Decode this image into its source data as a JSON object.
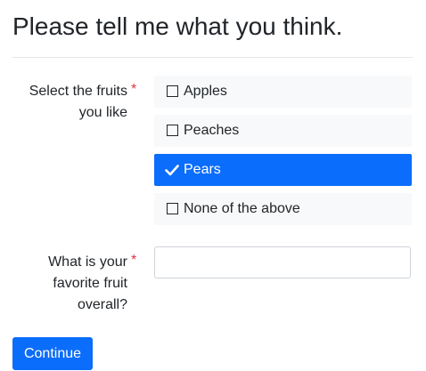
{
  "page": {
    "title": "Please tell me what you think."
  },
  "fruits_question": {
    "label_line1": "Select the fruits",
    "label_line2": "you like",
    "required_mark": "*",
    "options": [
      {
        "label": "Apples",
        "selected": false
      },
      {
        "label": "Peaches",
        "selected": false
      },
      {
        "label": "Pears",
        "selected": true
      },
      {
        "label": "None of the above",
        "selected": false
      }
    ]
  },
  "favorite_question": {
    "label_line1": "What is your",
    "label_line2": "favorite fruit",
    "label_line3": "overall?",
    "required_mark": "*",
    "value": "",
    "placeholder": ""
  },
  "actions": {
    "continue_label": "Continue"
  },
  "colors": {
    "accent": "#0b6dfb",
    "required": "#dc3545",
    "option_bg": "#f8f9fa"
  },
  "icons": {
    "unchecked": "checkbox-unchecked-icon",
    "checked": "checkmark-icon"
  }
}
